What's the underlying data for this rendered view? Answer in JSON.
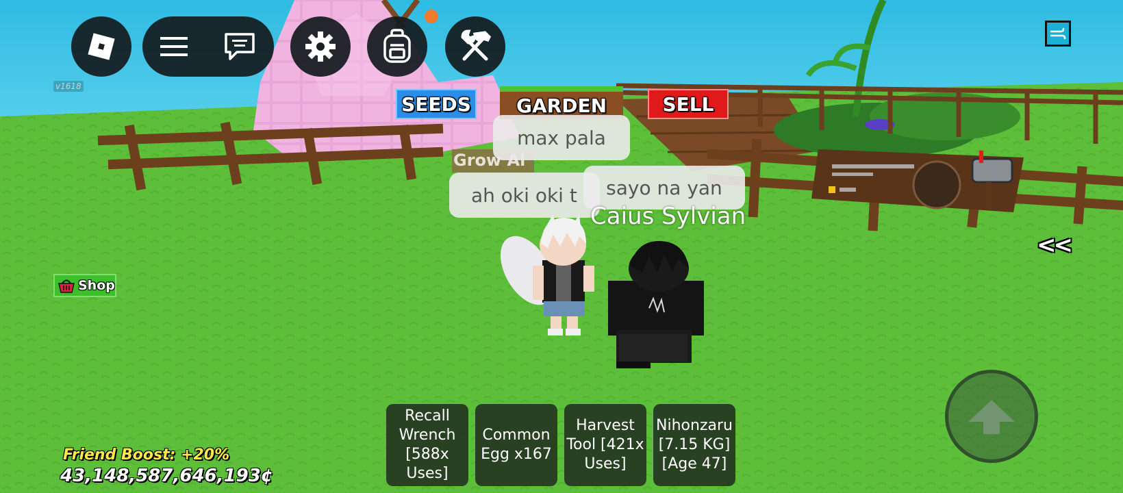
{
  "top_bar": {
    "version": "v1618",
    "icons": [
      "roblox-logo-icon",
      "menu-icon",
      "chat-icon",
      "gear-icon",
      "backpack-icon",
      "tools-icon"
    ]
  },
  "nav_signs": {
    "seeds": "SEEDS",
    "garden": "GARDEN",
    "sell": "SELL"
  },
  "world": {
    "grow_sign_text": "Grow Al",
    "player_name": "Caius Sylvian",
    "collapse_arrows": "<<"
  },
  "chat_bubbles": [
    {
      "text": "max pala"
    },
    {
      "text": "ah oki oki t"
    },
    {
      "text": "sayo na yan"
    }
  ],
  "shop": {
    "label": "Shop"
  },
  "hotbar": [
    {
      "label": "Recall\nWrench\n[588x\nUses]"
    },
    {
      "label": "Common\nEgg x167"
    },
    {
      "label": "Harvest\nTool [421x\nUses]"
    },
    {
      "label": "Nihonzaru\n[7.15 KG]\n[Age 47]"
    }
  ],
  "stats": {
    "friend_boost": "Friend Boost: +20%",
    "money": "43,148,587,646,193¢"
  },
  "colors": {
    "sky": "#39c6e6",
    "grass": "#5cbe3b",
    "seeds_bg": "#2a8ee8",
    "garden_bg": "#8a4e22",
    "sell_bg": "#e01a1a",
    "boost_text": "#ffe84a"
  }
}
